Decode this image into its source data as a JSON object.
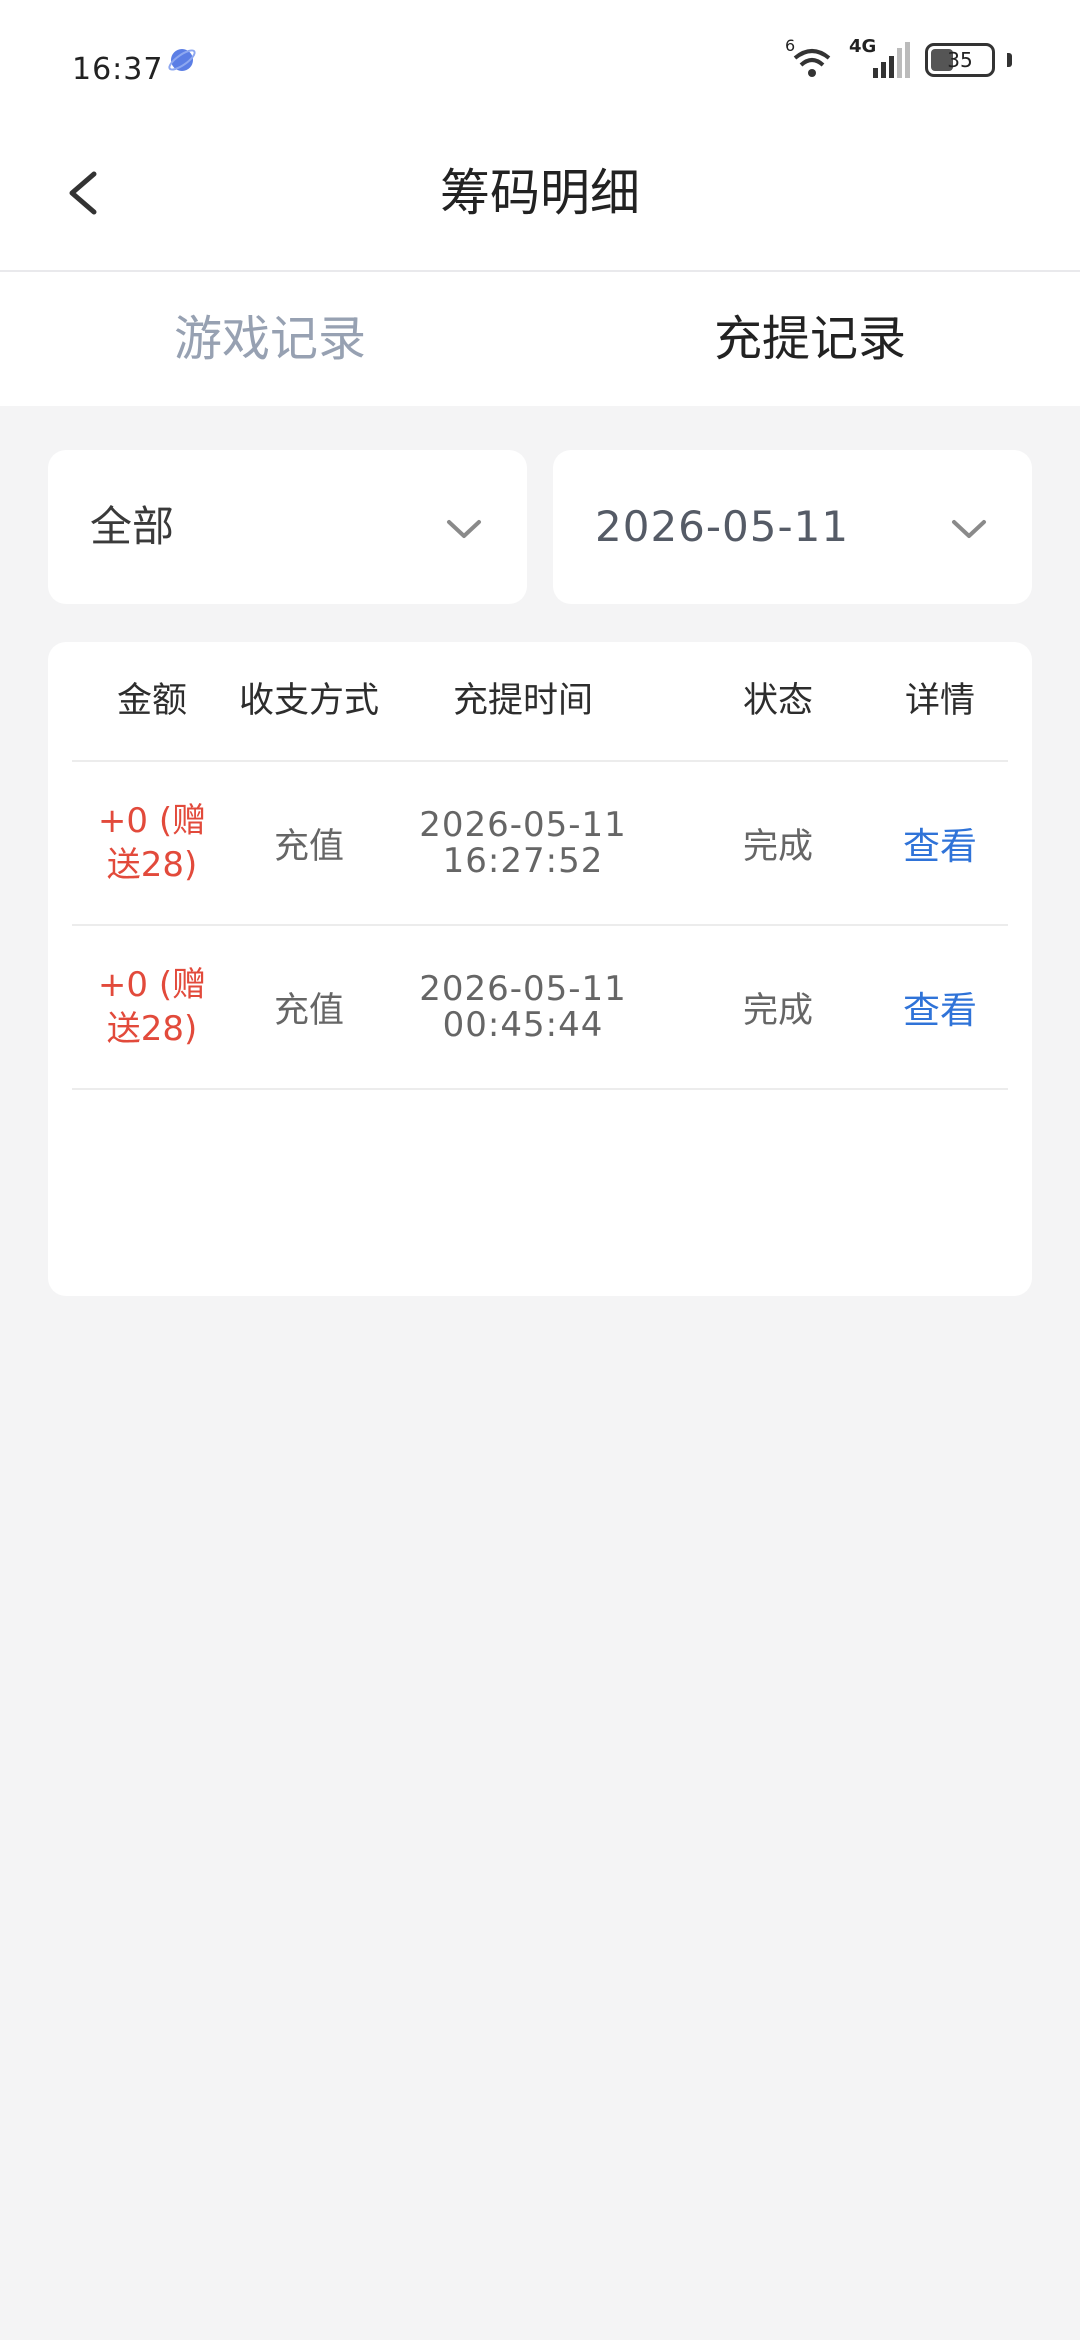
{
  "status_bar": {
    "time": "16:37",
    "network_label": "4G",
    "wifi_badge": "6",
    "battery": "35"
  },
  "header": {
    "title": "筹码明细"
  },
  "tabs": [
    {
      "label": "游戏记录",
      "active": false
    },
    {
      "label": "充提记录",
      "active": true
    }
  ],
  "filters": {
    "type_value": "全部",
    "date_value": "2026-05-11"
  },
  "table": {
    "columns": [
      "金额",
      "收支方式",
      "充提时间",
      "状态",
      "详情"
    ],
    "rows": [
      {
        "amount_line1": "+0 (赠",
        "amount_line2": "送28)",
        "type": "充值",
        "date": "2026-05-11",
        "time": "16:27:52",
        "status": "完成",
        "detail": "查看"
      },
      {
        "amount_line1": "+0 (赠",
        "amount_line2": "送28)",
        "type": "充值",
        "date": "2026-05-11",
        "time": "00:45:44",
        "status": "完成",
        "detail": "查看"
      }
    ]
  },
  "colors": {
    "amount": "#e24a3b",
    "link": "#2f73d8",
    "inactive_tab": "#97a1b2",
    "background": "#f4f4f5"
  }
}
